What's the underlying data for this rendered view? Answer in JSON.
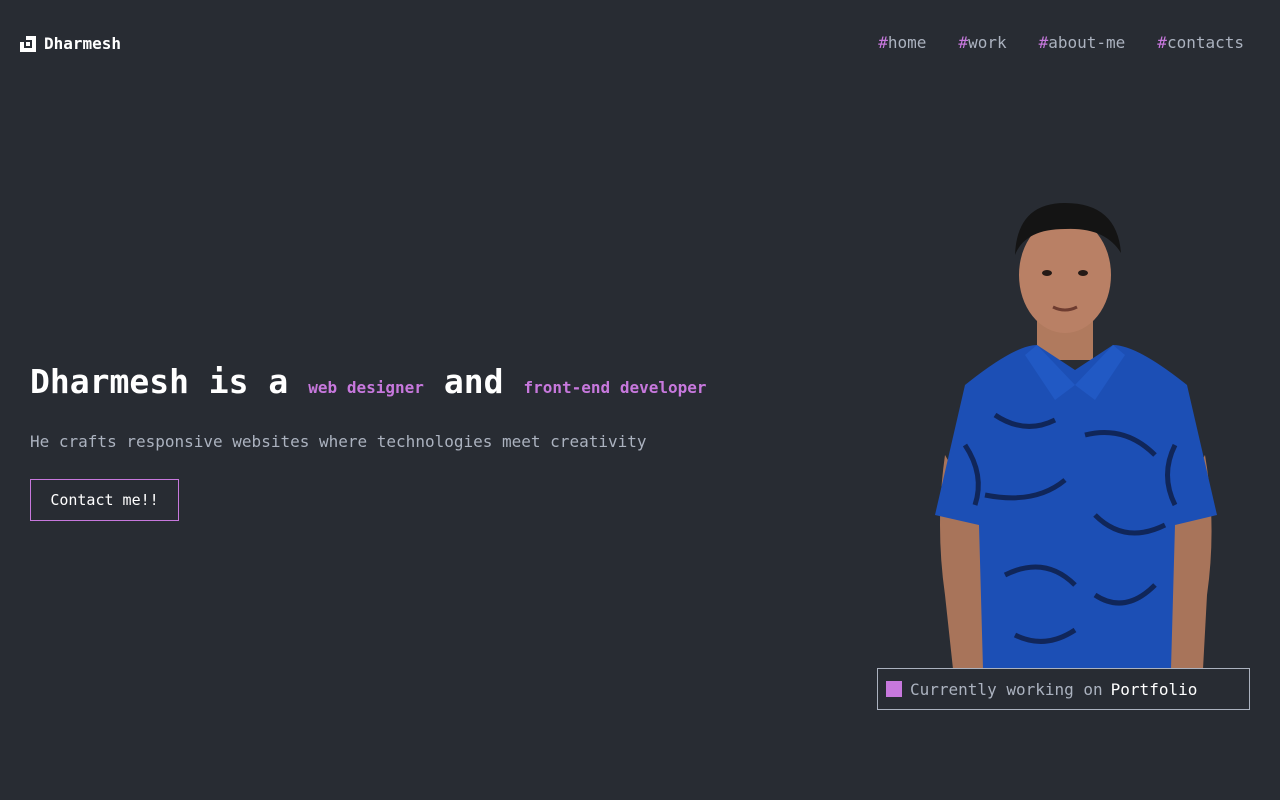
{
  "header": {
    "brand": "Dharmesh",
    "nav": [
      {
        "hash": "#",
        "label": "home"
      },
      {
        "hash": "#",
        "label": "work"
      },
      {
        "hash": "#",
        "label": "about-me"
      },
      {
        "hash": "#",
        "label": "contacts"
      }
    ]
  },
  "hero": {
    "headline_part1": "Dharmesh is a",
    "role1": "web designer",
    "headline_part2": "and",
    "role2": "front-end developer",
    "subtitle": "He crafts responsive websites where technologies meet creativity",
    "cta_label": "Contact me!!"
  },
  "status": {
    "prefix": "Currently working on",
    "project": "Portfolio"
  },
  "colors": {
    "background": "#282c33",
    "accent": "#c778dd",
    "text_muted": "#abb2bf",
    "text": "#ffffff"
  }
}
